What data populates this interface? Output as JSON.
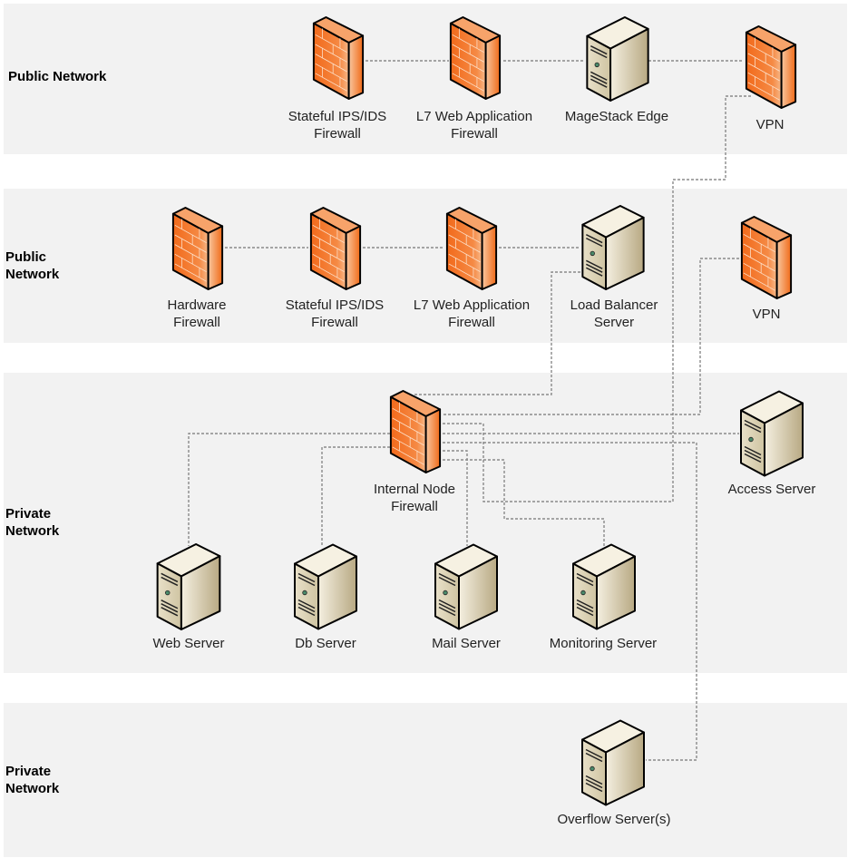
{
  "zones": [
    {
      "label_lines": [
        "Public Network"
      ]
    },
    {
      "label_lines": [
        "Public",
        "Network"
      ]
    },
    {
      "label_lines": [
        "Private",
        "Network"
      ]
    },
    {
      "label_lines": [
        "Private",
        "Network"
      ]
    }
  ],
  "nodes": {
    "stateful_fw_1": {
      "type": "firewall-icon",
      "lines": [
        "Stateful IPS/IDS",
        "Firewall"
      ]
    },
    "l7_waf_1": {
      "type": "firewall-icon",
      "lines": [
        "L7 Web Application",
        "Firewall"
      ]
    },
    "magestack_edge": {
      "type": "server-icon",
      "lines": [
        "MageStack Edge"
      ]
    },
    "vpn_1": {
      "type": "firewall-icon",
      "lines": [
        "VPN"
      ]
    },
    "hardware_fw": {
      "type": "firewall-icon",
      "lines": [
        "Hardware",
        "Firewall"
      ]
    },
    "stateful_fw_2": {
      "type": "firewall-icon",
      "lines": [
        "Stateful IPS/IDS",
        "Firewall"
      ]
    },
    "l7_waf_2": {
      "type": "firewall-icon",
      "lines": [
        "L7 Web Application",
        "Firewall"
      ]
    },
    "load_balancer": {
      "type": "server-icon",
      "lines": [
        "Load Balancer",
        "Server"
      ]
    },
    "vpn_2": {
      "type": "firewall-icon",
      "lines": [
        "VPN"
      ]
    },
    "internal_fw": {
      "type": "firewall-icon",
      "lines": [
        "Internal Node",
        "Firewall"
      ]
    },
    "access_server": {
      "type": "server-icon",
      "lines": [
        "Access Server"
      ]
    },
    "web_server": {
      "type": "server-icon",
      "lines": [
        "Web Server"
      ]
    },
    "db_server": {
      "type": "server-icon",
      "lines": [
        "Db Server"
      ]
    },
    "mail_server": {
      "type": "server-icon",
      "lines": [
        "Mail Server"
      ]
    },
    "monitoring_server": {
      "type": "server-icon",
      "lines": [
        "Monitoring Server"
      ]
    },
    "overflow_server": {
      "type": "server-icon",
      "lines": [
        "Overflow Server(s)"
      ]
    }
  },
  "connections": [
    [
      "stateful_fw_1",
      "l7_waf_1"
    ],
    [
      "l7_waf_1",
      "magestack_edge"
    ],
    [
      "magestack_edge",
      "vpn_1"
    ],
    [
      "vpn_1",
      "internal_fw"
    ],
    [
      "hardware_fw",
      "stateful_fw_2"
    ],
    [
      "stateful_fw_2",
      "l7_waf_2"
    ],
    [
      "l7_waf_2",
      "load_balancer"
    ],
    [
      "load_balancer",
      "internal_fw"
    ],
    [
      "vpn_2",
      "internal_fw"
    ],
    [
      "internal_fw",
      "access_server"
    ],
    [
      "internal_fw",
      "overflow_server"
    ],
    [
      "internal_fw",
      "web_server"
    ],
    [
      "internal_fw",
      "db_server"
    ],
    [
      "internal_fw",
      "mail_server"
    ],
    [
      "internal_fw",
      "monitoring_server"
    ]
  ],
  "colors": {
    "band": "#f2f2f2",
    "firewall": "#f26a1b",
    "server": "#d9cfb4",
    "connector": "#8a8a8a"
  }
}
